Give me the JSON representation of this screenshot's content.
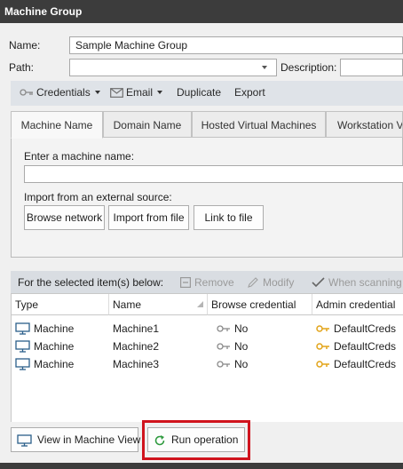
{
  "window": {
    "title": "Machine Group"
  },
  "form": {
    "name_label": "Name:",
    "name_value": "Sample Machine Group",
    "path_label": "Path:",
    "path_value": "",
    "description_label": "Description:",
    "description_value": ""
  },
  "toolbar": {
    "credentials": "Credentials",
    "email": "Email",
    "duplicate": "Duplicate",
    "export": "Export"
  },
  "tabs": [
    {
      "label": "Machine Name",
      "active": true
    },
    {
      "label": "Domain Name",
      "active": false
    },
    {
      "label": "Hosted Virtual Machines",
      "active": false
    },
    {
      "label": "Workstation VMs",
      "active": false
    }
  ],
  "machine_tab": {
    "enter_label": "Enter a machine name:",
    "enter_value": "",
    "import_label": "Import from an external source:",
    "browse_network": "Browse network",
    "import_from_file": "Import from file",
    "link_to_file": "Link to file"
  },
  "selection_bar": {
    "label": "For the selected item(s) below:",
    "remove": "Remove",
    "modify": "Modify",
    "when_scanning": "When scanning"
  },
  "grid": {
    "columns": [
      "Type",
      "Name",
      "Browse credential",
      "Admin credential"
    ],
    "rows": [
      {
        "type": "Machine",
        "name": "Machine1",
        "browse": "No",
        "admin": "DefaultCreds"
      },
      {
        "type": "Machine",
        "name": "Machine2",
        "browse": "No",
        "admin": "DefaultCreds"
      },
      {
        "type": "Machine",
        "name": "Machine3",
        "browse": "No",
        "admin": "DefaultCreds"
      }
    ]
  },
  "footer": {
    "view_in_machine_view": "View in Machine View",
    "run_operation": "Run operation"
  },
  "colors": {
    "titlebar": "#3c3c3c",
    "highlight": "#d0141e",
    "key_gold": "#e2a419",
    "run_green": "#2e9a3e"
  }
}
